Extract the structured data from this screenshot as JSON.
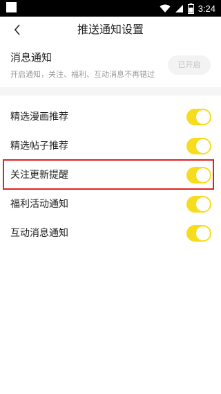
{
  "status_bar": {
    "time": "3:24"
  },
  "header": {
    "title": "推送通知设置"
  },
  "master": {
    "title": "消息通知",
    "description": "开启通知，关注、福利、互动消息不再错过",
    "button_label": "已开启"
  },
  "settings": [
    {
      "label": "精选漫画推荐",
      "enabled": true
    },
    {
      "label": "精选帖子推荐",
      "enabled": true
    },
    {
      "label": "关注更新提醒",
      "enabled": true,
      "highlighted": true
    },
    {
      "label": "福利活动通知",
      "enabled": true
    },
    {
      "label": "互动消息通知",
      "enabled": true
    }
  ],
  "colors": {
    "toggle_on": "#f7dc1e",
    "highlight_border": "#e02020"
  }
}
